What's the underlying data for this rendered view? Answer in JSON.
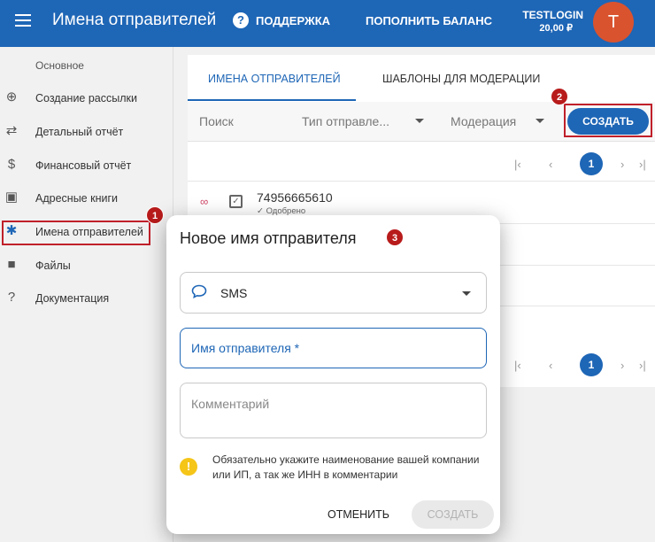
{
  "header": {
    "title": "Имена отправителей",
    "support": "ПОДДЕРЖКА",
    "top_up": "ПОПОЛНИТЬ БАЛАНС",
    "login": "TESTLOGIN",
    "balance": "20,00 ₽",
    "avatar_letter": "T"
  },
  "sidebar": {
    "section": "Основное",
    "items": [
      {
        "label": "Создание рассылки",
        "icon": "add-circle-icon"
      },
      {
        "label": "Детальный отчёт",
        "icon": "swap-arrows-icon"
      },
      {
        "label": "Финансовый отчёт",
        "icon": "dollar-icon"
      },
      {
        "label": "Адресные книги",
        "icon": "contact-card-icon"
      },
      {
        "label": "Имена отправителей",
        "icon": "puzzle-icon",
        "active": true
      },
      {
        "label": "Файлы",
        "icon": "folder-icon"
      },
      {
        "label": "Документация",
        "icon": "help-icon"
      }
    ]
  },
  "main": {
    "tabs": [
      {
        "label": "ИМЕНА ОТПРАВИТЕЛЕЙ",
        "active": true
      },
      {
        "label": "ШАБЛОНЫ ДЛЯ МОДЕРАЦИИ",
        "active": false
      }
    ],
    "filters": {
      "search": "Поиск",
      "type": "Тип отправле...",
      "moderation": "Модерация"
    },
    "create_button": "СОЗДАТЬ",
    "pager": {
      "first": "|‹",
      "prev": "‹",
      "current": "1",
      "next": "›",
      "last": "›|"
    },
    "rows": [
      {
        "number": "74956665610",
        "status": "✓ Одобрено"
      }
    ]
  },
  "dialog": {
    "title": "Новое имя отправителя",
    "channel": "SMS",
    "name_placeholder": "Имя отправителя *",
    "comment_placeholder": "Комментарий",
    "warning": "Обязательно укажите наименование вашей компании или ИП, а так же ИНН в комментарии",
    "cancel": "ОТМЕНИТЬ",
    "create": "СОЗДАТЬ"
  },
  "markers": {
    "one": "1",
    "two": "2",
    "three": "3"
  },
  "colors": {
    "primary": "#1e66b6",
    "avatar": "#d9532f",
    "marker": "#b81b1b",
    "warning": "#f5c518"
  }
}
